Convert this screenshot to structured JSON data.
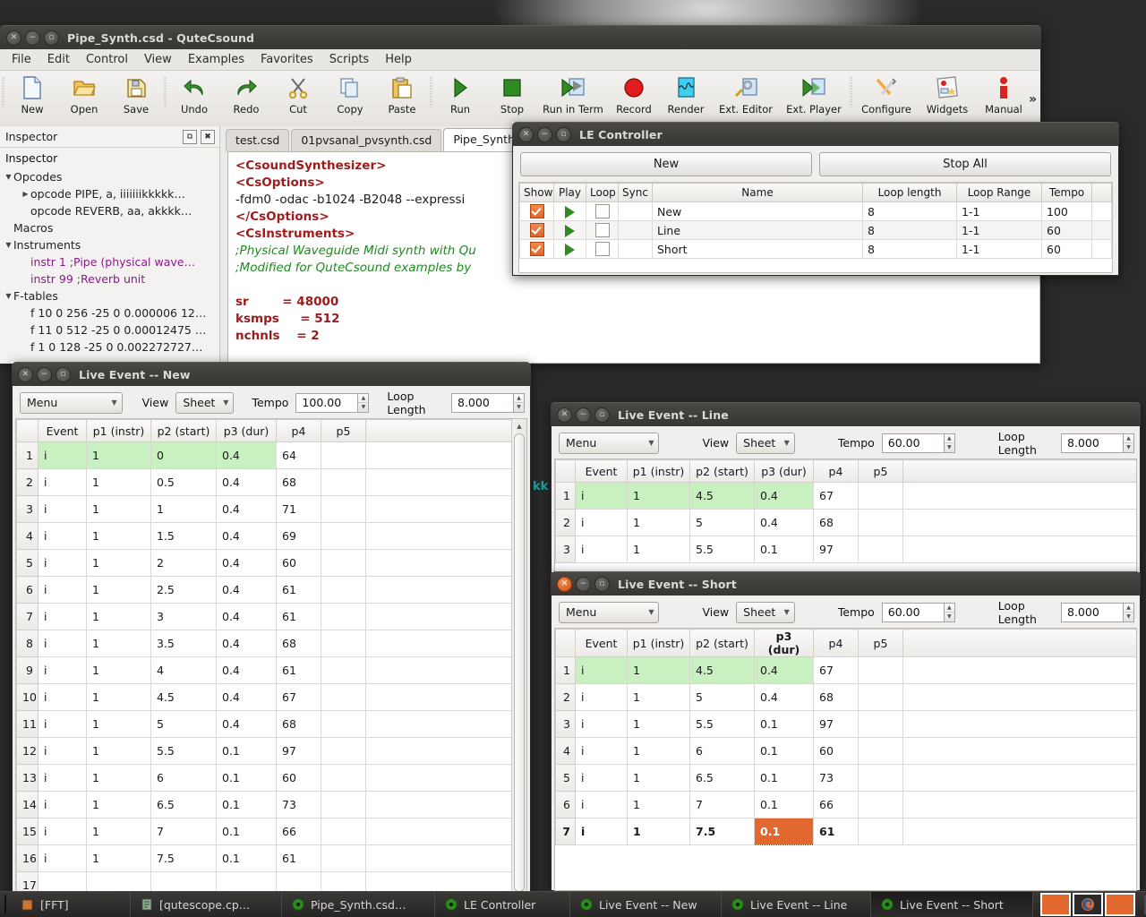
{
  "main_window": {
    "title": "Pipe_Synth.csd - QuteCsound",
    "menus": [
      "File",
      "Edit",
      "Control",
      "View",
      "Examples",
      "Favorites",
      "Scripts",
      "Help"
    ],
    "toolbar": [
      {
        "label": "New",
        "icon": "new-document-icon"
      },
      {
        "label": "Open",
        "icon": "open-folder-icon"
      },
      {
        "label": "Save",
        "icon": "save-floppy-icon"
      },
      {
        "label": "Undo",
        "icon": "undo-arrow-icon"
      },
      {
        "label": "Redo",
        "icon": "redo-arrow-icon"
      },
      {
        "label": "Cut",
        "icon": "scissors-icon"
      },
      {
        "label": "Copy",
        "icon": "copy-icon"
      },
      {
        "label": "Paste",
        "icon": "paste-clipboard-icon"
      },
      {
        "label": "Run",
        "icon": "play-triangle-icon"
      },
      {
        "label": "Stop",
        "icon": "stop-square-icon"
      },
      {
        "label": "Run in Term",
        "icon": "run-in-terminal-icon"
      },
      {
        "label": "Record",
        "icon": "record-circle-icon"
      },
      {
        "label": "Render",
        "icon": "render-waveform-icon"
      },
      {
        "label": "Ext. Editor",
        "icon": "external-editor-icon"
      },
      {
        "label": "Ext. Player",
        "icon": "external-player-icon"
      },
      {
        "label": "Configure",
        "icon": "configure-tools-icon"
      },
      {
        "label": "Widgets",
        "icon": "widgets-icon"
      },
      {
        "label": "Manual",
        "icon": "manual-person-icon"
      }
    ],
    "overflow_label": "»"
  },
  "inspector": {
    "header_title": "Inspector",
    "panel_title": "Inspector",
    "undock_icon": "undock-icon",
    "close_icon": "close-panel-icon",
    "tree": [
      {
        "label": "Opcodes",
        "level": 1,
        "twisty": "▼"
      },
      {
        "label": "opcode PIPE, a, iiiiiiikkkkk…",
        "level": 2,
        "twisty": "▶"
      },
      {
        "label": "opcode REVERB, aa, akkkk…",
        "level": 2,
        "twisty": ""
      },
      {
        "label": "Macros",
        "level": 1,
        "twisty": ""
      },
      {
        "label": "Instruments",
        "level": 1,
        "twisty": "▼"
      },
      {
        "label": "instr 1 ;Pipe (physical wave…",
        "level": 2,
        "twisty": "",
        "style": "purple"
      },
      {
        "label": "instr 99 ;Reverb unit",
        "level": 2,
        "twisty": "",
        "style": "purple"
      },
      {
        "label": "F-tables",
        "level": 1,
        "twisty": "▼"
      },
      {
        "label": "f 10 0 256 -25 0 0.000006 12…",
        "level": 2,
        "twisty": ""
      },
      {
        "label": "f 11 0 512 -25 0 0.00012475 …",
        "level": 2,
        "twisty": ""
      },
      {
        "label": "f 1 0 128 -25 0 0.002272727…",
        "level": 2,
        "twisty": ""
      }
    ]
  },
  "editor": {
    "tabs": [
      {
        "label": "test.csd",
        "active": false
      },
      {
        "label": "01pvsanal_pvsynth.csd",
        "active": false
      },
      {
        "label": "Pipe_Synth",
        "active": true
      }
    ],
    "lines": [
      {
        "text": "<CsoundSynthesizer>",
        "style": "tag"
      },
      {
        "text": "<CsOptions>",
        "style": "tag"
      },
      {
        "text": "-fdm0 -odac -b1024 -B2048 --expressi",
        "style": "options"
      },
      {
        "text": "</CsOptions>",
        "style": "tag"
      },
      {
        "text": "<CsInstruments>",
        "style": "tag"
      },
      {
        "text": ";Physical Waveguide Midi synth with Qu",
        "style": "comment"
      },
      {
        "text": ";Modified for QuteCsound examples by",
        "style": "comment"
      },
      {
        "text": "",
        "style": "blank"
      },
      {
        "text": "sr        = 48000",
        "style": "kw"
      },
      {
        "text": "ksmps     = 512",
        "style": "kw"
      },
      {
        "text": "nchnls    = 2",
        "style": "kw"
      }
    ],
    "peek_text": "kk"
  },
  "le_controller": {
    "title": "LE Controller",
    "new_button": "New",
    "stop_all_button": "Stop All",
    "columns": [
      "Show",
      "Play",
      "Loop",
      "Sync",
      "Name",
      "Loop length",
      "Loop Range",
      "Tempo"
    ],
    "rows": [
      {
        "show": true,
        "play": "play-icon",
        "loop": false,
        "sync": "",
        "name": "New",
        "loop_length": "8",
        "loop_range": "1-1",
        "tempo": "100"
      },
      {
        "show": true,
        "play": "play-icon",
        "loop": false,
        "sync": "",
        "name": "Line",
        "loop_length": "8",
        "loop_range": "1-1",
        "tempo": "60"
      },
      {
        "show": true,
        "play": "play-icon",
        "loop": false,
        "sync": "",
        "name": "Short",
        "loop_length": "8",
        "loop_range": "1-1",
        "tempo": "60"
      }
    ]
  },
  "live_event_new": {
    "title": "Live Event -- New",
    "menu_label": "Menu",
    "view_label": "View",
    "view_value": "Sheet",
    "tempo_label": "Tempo",
    "tempo_value": "100.00",
    "loop_length_label": "Loop Length",
    "loop_length_value": "8.000",
    "columns": [
      "",
      "Event",
      "p1 (instr)",
      "p2 (start)",
      "p3 (dur)",
      "p4",
      "p5",
      ""
    ],
    "rows": [
      {
        "n": "1",
        "event": "i",
        "p1": "1",
        "p2": "0",
        "p3": "0.4",
        "p4": "64",
        "p5": "",
        "selected": true
      },
      {
        "n": "2",
        "event": "i",
        "p1": "1",
        "p2": "0.5",
        "p3": "0.4",
        "p4": "68",
        "p5": ""
      },
      {
        "n": "3",
        "event": "i",
        "p1": "1",
        "p2": "1",
        "p3": "0.4",
        "p4": "71",
        "p5": ""
      },
      {
        "n": "4",
        "event": "i",
        "p1": "1",
        "p2": "1.5",
        "p3": "0.4",
        "p4": "69",
        "p5": ""
      },
      {
        "n": "5",
        "event": "i",
        "p1": "1",
        "p2": "2",
        "p3": "0.4",
        "p4": "60",
        "p5": ""
      },
      {
        "n": "6",
        "event": "i",
        "p1": "1",
        "p2": "2.5",
        "p3": "0.4",
        "p4": "61",
        "p5": ""
      },
      {
        "n": "7",
        "event": "i",
        "p1": "1",
        "p2": "3",
        "p3": "0.4",
        "p4": "61",
        "p5": ""
      },
      {
        "n": "8",
        "event": "i",
        "p1": "1",
        "p2": "3.5",
        "p3": "0.4",
        "p4": "68",
        "p5": ""
      },
      {
        "n": "9",
        "event": "i",
        "p1": "1",
        "p2": "4",
        "p3": "0.4",
        "p4": "61",
        "p5": ""
      },
      {
        "n": "10",
        "event": "i",
        "p1": "1",
        "p2": "4.5",
        "p3": "0.4",
        "p4": "67",
        "p5": ""
      },
      {
        "n": "11",
        "event": "i",
        "p1": "1",
        "p2": "5",
        "p3": "0.4",
        "p4": "68",
        "p5": ""
      },
      {
        "n": "12",
        "event": "i",
        "p1": "1",
        "p2": "5.5",
        "p3": "0.1",
        "p4": "97",
        "p5": ""
      },
      {
        "n": "13",
        "event": "i",
        "p1": "1",
        "p2": "6",
        "p3": "0.1",
        "p4": "60",
        "p5": ""
      },
      {
        "n": "14",
        "event": "i",
        "p1": "1",
        "p2": "6.5",
        "p3": "0.1",
        "p4": "73",
        "p5": ""
      },
      {
        "n": "15",
        "event": "i",
        "p1": "1",
        "p2": "7",
        "p3": "0.1",
        "p4": "66",
        "p5": ""
      },
      {
        "n": "16",
        "event": "i",
        "p1": "1",
        "p2": "7.5",
        "p3": "0.1",
        "p4": "61",
        "p5": ""
      },
      {
        "n": "17",
        "event": "",
        "p1": "",
        "p2": "",
        "p3": "",
        "p4": "",
        "p5": ""
      }
    ]
  },
  "live_event_line": {
    "title": "Live Event -- Line",
    "menu_label": "Menu",
    "view_label": "View",
    "view_value": "Sheet",
    "tempo_label": "Tempo",
    "tempo_value": "60.00",
    "loop_length_label": "Loop Length",
    "loop_length_value": "8.000",
    "columns": [
      "",
      "Event",
      "p1 (instr)",
      "p2 (start)",
      "p3 (dur)",
      "p4",
      "p5",
      ""
    ],
    "rows": [
      {
        "n": "1",
        "event": "i",
        "p1": "1",
        "p2": "4.5",
        "p3": "0.4",
        "p4": "67",
        "p5": "",
        "selected": true
      },
      {
        "n": "2",
        "event": "i",
        "p1": "1",
        "p2": "5",
        "p3": "0.4",
        "p4": "68",
        "p5": ""
      },
      {
        "n": "3",
        "event": "i",
        "p1": "1",
        "p2": "5.5",
        "p3": "0.1",
        "p4": "97",
        "p5": ""
      }
    ]
  },
  "live_event_short": {
    "title": "Live Event -- Short",
    "menu_label": "Menu",
    "view_label": "View",
    "view_value": "Sheet",
    "tempo_label": "Tempo",
    "tempo_value": "60.00",
    "loop_length_label": "Loop Length",
    "loop_length_value": "8.000",
    "columns": [
      "",
      "Event",
      "p1 (instr)",
      "p2 (start)",
      "p3 (dur)",
      "p4",
      "p5",
      ""
    ],
    "sorted_column": "p3 (dur)",
    "rows": [
      {
        "n": "1",
        "event": "i",
        "p1": "1",
        "p2": "4.5",
        "p3": "0.4",
        "p4": "67",
        "p5": "",
        "selected": true
      },
      {
        "n": "2",
        "event": "i",
        "p1": "1",
        "p2": "5",
        "p3": "0.4",
        "p4": "68",
        "p5": ""
      },
      {
        "n": "3",
        "event": "i",
        "p1": "1",
        "p2": "5.5",
        "p3": "0.1",
        "p4": "97",
        "p5": ""
      },
      {
        "n": "4",
        "event": "i",
        "p1": "1",
        "p2": "6",
        "p3": "0.1",
        "p4": "60",
        "p5": ""
      },
      {
        "n": "5",
        "event": "i",
        "p1": "1",
        "p2": "6.5",
        "p3": "0.1",
        "p4": "73",
        "p5": ""
      },
      {
        "n": "6",
        "event": "i",
        "p1": "1",
        "p2": "7",
        "p3": "0.1",
        "p4": "66",
        "p5": ""
      },
      {
        "n": "7",
        "event": "i",
        "p1": "1",
        "p2": "7.5",
        "p3": "0.1",
        "p4": "61",
        "p5": "",
        "bold": true,
        "cell_selected": "p3"
      }
    ]
  },
  "taskbar": {
    "items": [
      {
        "label": "[FFT]",
        "icon": "window-icon",
        "active": false
      },
      {
        "label": "[qutescope.cp…",
        "icon": "document-icon",
        "active": false
      },
      {
        "label": "Pipe_Synth.csd…",
        "icon": "qutecsound-icon",
        "active": false
      },
      {
        "label": "LE Controller",
        "icon": "qutecsound-icon",
        "active": false
      },
      {
        "label": "Live Event -- New",
        "icon": "qutecsound-icon",
        "active": false
      },
      {
        "label": "Live Event -- Line",
        "icon": "qutecsound-icon",
        "active": false
      },
      {
        "label": "Live Event -- Short",
        "icon": "qutecsound-icon",
        "active": true
      }
    ],
    "workspace_switcher_icon": "workspace-switcher-icon",
    "firefox_icon": "firefox-icon",
    "trash_icon": "trash-icon"
  },
  "colors": {
    "accent_orange": "#e3682f",
    "selection_green": "#c8f0c0",
    "titlebar_dark": "#403e3b",
    "comment_green": "#1f8a1f",
    "tag_red": "#a01c1c",
    "instr_purple": "#8b1a8b"
  }
}
